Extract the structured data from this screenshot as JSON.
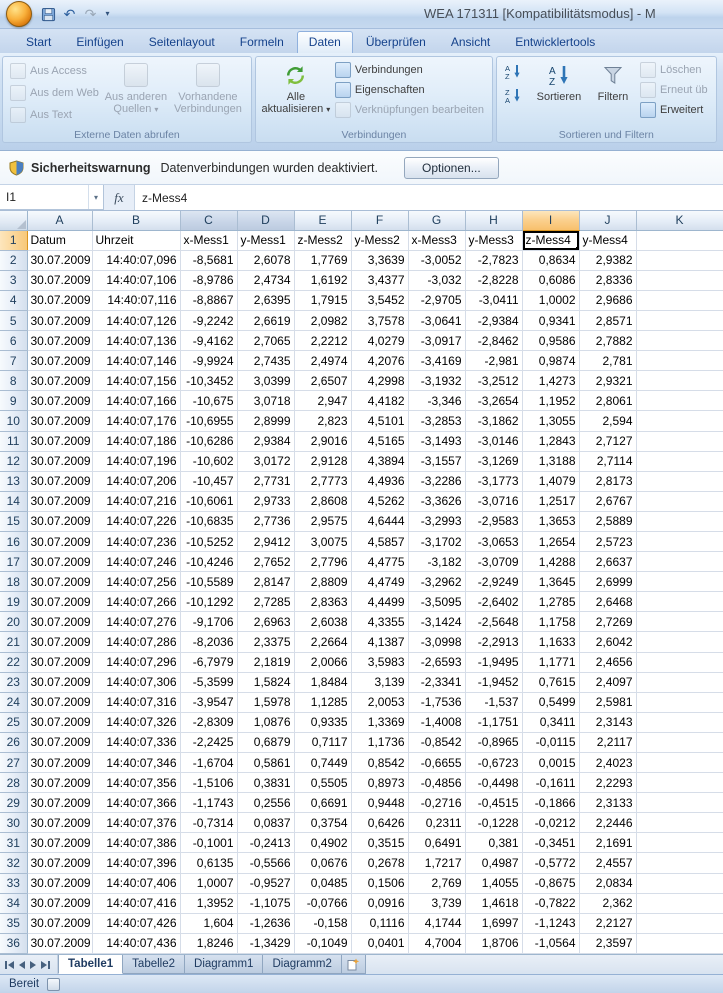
{
  "window": {
    "title": "WEA 171311  [Kompatibilitätsmodus] - M",
    "status": "Bereit"
  },
  "icons": {
    "caret": "▾",
    "undo": "↶",
    "redo": "↷"
  },
  "ribbon": {
    "tabs": [
      "Start",
      "Einfügen",
      "Seitenlayout",
      "Formeln",
      "Daten",
      "Überprüfen",
      "Ansicht",
      "Entwicklertools"
    ],
    "active_tab": "Daten",
    "external": {
      "label": "Externe Daten abrufen",
      "aus_access": "Aus Access",
      "aus_dem_web": "Aus dem Web",
      "aus_text": "Aus Text",
      "andere_quellen": "Aus anderen Quellen",
      "vorhandene": "Vorhandene Verbindungen"
    },
    "verbindungen": {
      "label": "Verbindungen",
      "alle_aktualisieren": "Alle aktualisieren",
      "verbindungen": "Verbindungen",
      "eigenschaften": "Eigenschaften",
      "verknuepfungen": "Verknüpfungen bearbeiten"
    },
    "sortieren_filtern": {
      "label": "Sortieren und Filtern",
      "sortieren": "Sortieren",
      "filtern": "Filtern",
      "loeschen": "Löschen",
      "erneut": "Erneut üb",
      "erweitert": "Erweitert"
    }
  },
  "security_bar": {
    "title": "Sicherheitswarnung",
    "message": "Datenverbindungen wurden deaktiviert.",
    "button": "Optionen..."
  },
  "formula_bar": {
    "name_box": "I1",
    "formula": "z-Mess4"
  },
  "sheet": {
    "columns": [
      "A",
      "B",
      "C",
      "D",
      "E",
      "F",
      "G",
      "H",
      "I",
      "J",
      "K"
    ],
    "shaded_columns": [
      "C",
      "D"
    ],
    "selection": {
      "cell": "I1",
      "column": "I",
      "row": 1
    },
    "header_row": [
      "Datum",
      "Uhrzeit",
      "x-Mess1",
      "y-Mess1",
      "z-Mess2",
      "y-Mess2",
      "x-Mess3",
      "y-Mess3",
      "z-Mess4",
      "y-Mess4"
    ],
    "rows": [
      [
        "30.07.2009",
        "14:40:07,096",
        "-8,5681",
        "2,6078",
        "1,7769",
        "3,3639",
        "-3,0052",
        "-2,7823",
        "0,8634",
        "2,9382"
      ],
      [
        "30.07.2009",
        "14:40:07,106",
        "-8,9786",
        "2,4734",
        "1,6192",
        "3,4377",
        "-3,032",
        "-2,8228",
        "0,6086",
        "2,8336"
      ],
      [
        "30.07.2009",
        "14:40:07,116",
        "-8,8867",
        "2,6395",
        "1,7915",
        "3,5452",
        "-2,9705",
        "-3,0411",
        "1,0002",
        "2,9686"
      ],
      [
        "30.07.2009",
        "14:40:07,126",
        "-9,2242",
        "2,6619",
        "2,0982",
        "3,7578",
        "-3,0641",
        "-2,9384",
        "0,9341",
        "2,8571"
      ],
      [
        "30.07.2009",
        "14:40:07,136",
        "-9,4162",
        "2,7065",
        "2,2212",
        "4,0279",
        "-3,0917",
        "-2,8462",
        "0,9586",
        "2,7882"
      ],
      [
        "30.07.2009",
        "14:40:07,146",
        "-9,9924",
        "2,7435",
        "2,4974",
        "4,2076",
        "-3,4169",
        "-2,981",
        "0,9874",
        "2,781"
      ],
      [
        "30.07.2009",
        "14:40:07,156",
        "-10,3452",
        "3,0399",
        "2,6507",
        "4,2998",
        "-3,1932",
        "-3,2512",
        "1,4273",
        "2,9321"
      ],
      [
        "30.07.2009",
        "14:40:07,166",
        "-10,675",
        "3,0718",
        "2,947",
        "4,4182",
        "-3,346",
        "-3,2654",
        "1,1952",
        "2,8061"
      ],
      [
        "30.07.2009",
        "14:40:07,176",
        "-10,6955",
        "2,8999",
        "2,823",
        "4,5101",
        "-3,2853",
        "-3,1862",
        "1,3055",
        "2,594"
      ],
      [
        "30.07.2009",
        "14:40:07,186",
        "-10,6286",
        "2,9384",
        "2,9016",
        "4,5165",
        "-3,1493",
        "-3,0146",
        "1,2843",
        "2,7127"
      ],
      [
        "30.07.2009",
        "14:40:07,196",
        "-10,602",
        "3,0172",
        "2,9128",
        "4,3894",
        "-3,1557",
        "-3,1269",
        "1,3188",
        "2,7114"
      ],
      [
        "30.07.2009",
        "14:40:07,206",
        "-10,457",
        "2,7731",
        "2,7773",
        "4,4936",
        "-3,2286",
        "-3,1773",
        "1,4079",
        "2,8173"
      ],
      [
        "30.07.2009",
        "14:40:07,216",
        "-10,6061",
        "2,9733",
        "2,8608",
        "4,5262",
        "-3,3626",
        "-3,0716",
        "1,2517",
        "2,6767"
      ],
      [
        "30.07.2009",
        "14:40:07,226",
        "-10,6835",
        "2,7736",
        "2,9575",
        "4,6444",
        "-3,2993",
        "-2,9583",
        "1,3653",
        "2,5889"
      ],
      [
        "30.07.2009",
        "14:40:07,236",
        "-10,5252",
        "2,9412",
        "3,0075",
        "4,5857",
        "-3,1702",
        "-3,0653",
        "1,2654",
        "2,5723"
      ],
      [
        "30.07.2009",
        "14:40:07,246",
        "-10,4246",
        "2,7652",
        "2,7796",
        "4,4775",
        "-3,182",
        "-3,0709",
        "1,4288",
        "2,6637"
      ],
      [
        "30.07.2009",
        "14:40:07,256",
        "-10,5589",
        "2,8147",
        "2,8809",
        "4,4749",
        "-3,2962",
        "-2,9249",
        "1,3645",
        "2,6999"
      ],
      [
        "30.07.2009",
        "14:40:07,266",
        "-10,1292",
        "2,7285",
        "2,8363",
        "4,4499",
        "-3,5095",
        "-2,6402",
        "1,2785",
        "2,6468"
      ],
      [
        "30.07.2009",
        "14:40:07,276",
        "-9,1706",
        "2,6963",
        "2,6038",
        "4,3355",
        "-3,1424",
        "-2,5648",
        "1,1758",
        "2,7269"
      ],
      [
        "30.07.2009",
        "14:40:07,286",
        "-8,2036",
        "2,3375",
        "2,2664",
        "4,1387",
        "-3,0998",
        "-2,2913",
        "1,1633",
        "2,6042"
      ],
      [
        "30.07.2009",
        "14:40:07,296",
        "-6,7979",
        "2,1819",
        "2,0066",
        "3,5983",
        "-2,6593",
        "-1,9495",
        "1,1771",
        "2,4656"
      ],
      [
        "30.07.2009",
        "14:40:07,306",
        "-5,3599",
        "1,5824",
        "1,8484",
        "3,139",
        "-2,3341",
        "-1,9452",
        "0,7615",
        "2,4097"
      ],
      [
        "30.07.2009",
        "14:40:07,316",
        "-3,9547",
        "1,5978",
        "1,1285",
        "2,0053",
        "-1,7536",
        "-1,537",
        "0,5499",
        "2,5981"
      ],
      [
        "30.07.2009",
        "14:40:07,326",
        "-2,8309",
        "1,0876",
        "0,9335",
        "1,3369",
        "-1,4008",
        "-1,1751",
        "0,3411",
        "2,3143"
      ],
      [
        "30.07.2009",
        "14:40:07,336",
        "-2,2425",
        "0,6879",
        "0,7117",
        "1,1736",
        "-0,8542",
        "-0,8965",
        "-0,0115",
        "2,2117"
      ],
      [
        "30.07.2009",
        "14:40:07,346",
        "-1,6704",
        "0,5861",
        "0,7449",
        "0,8542",
        "-0,6655",
        "-0,6723",
        "0,0015",
        "2,4023"
      ],
      [
        "30.07.2009",
        "14:40:07,356",
        "-1,5106",
        "0,3831",
        "0,5505",
        "0,8973",
        "-0,4856",
        "-0,4498",
        "-0,1611",
        "2,2293"
      ],
      [
        "30.07.2009",
        "14:40:07,366",
        "-1,1743",
        "0,2556",
        "0,6691",
        "0,9448",
        "-0,2716",
        "-0,4515",
        "-0,1866",
        "2,3133"
      ],
      [
        "30.07.2009",
        "14:40:07,376",
        "-0,7314",
        "0,0837",
        "0,3754",
        "0,6426",
        "0,2311",
        "-0,1228",
        "-0,0212",
        "2,2446"
      ],
      [
        "30.07.2009",
        "14:40:07,386",
        "-0,1001",
        "-0,2413",
        "0,4902",
        "0,3515",
        "0,6491",
        "0,381",
        "-0,3451",
        "2,1691"
      ],
      [
        "30.07.2009",
        "14:40:07,396",
        "0,6135",
        "-0,5566",
        "0,0676",
        "0,2678",
        "1,7217",
        "0,4987",
        "-0,5772",
        "2,4557"
      ],
      [
        "30.07.2009",
        "14:40:07,406",
        "1,0007",
        "-0,9527",
        "0,0485",
        "0,1506",
        "2,769",
        "1,4055",
        "-0,8675",
        "2,0834"
      ],
      [
        "30.07.2009",
        "14:40:07,416",
        "1,3952",
        "-1,1075",
        "-0,0766",
        "0,0916",
        "3,739",
        "1,4618",
        "-0,7822",
        "2,362"
      ],
      [
        "30.07.2009",
        "14:40:07,426",
        "1,604",
        "-1,2636",
        "-0,158",
        "0,1116",
        "4,1744",
        "1,6997",
        "-1,1243",
        "2,2127"
      ],
      [
        "30.07.2009",
        "14:40:07,436",
        "1,8246",
        "-1,3429",
        "-0,1049",
        "0,0401",
        "4,7004",
        "1,8706",
        "-1,0564",
        "2,3597"
      ]
    ]
  },
  "sheets": {
    "tabs": [
      "Tabelle1",
      "Tabelle2",
      "Diagramm1",
      "Diagramm2"
    ],
    "active": "Tabelle1"
  }
}
